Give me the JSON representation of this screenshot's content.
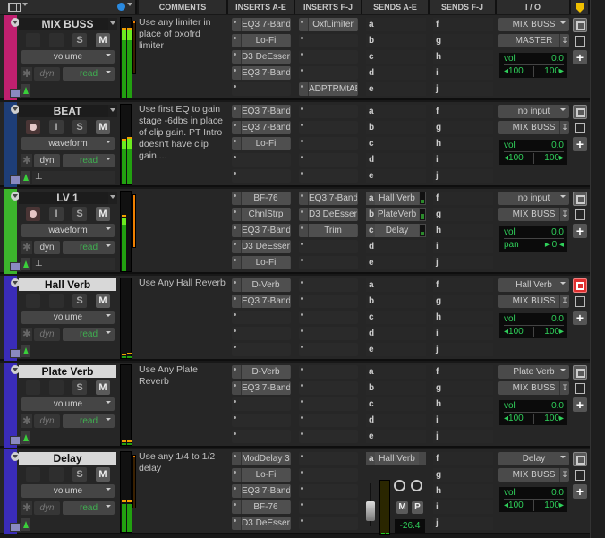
{
  "header": {
    "columns": [
      "COMMENTS",
      "INSERTS A-E",
      "INSERTS F-J",
      "SENDS A-E",
      "SENDS F-J",
      "I / O"
    ],
    "icons": [
      "track-view-icon",
      "wave-cache-icon",
      "marker-icon"
    ]
  },
  "colors": {
    "mix_buss": "#c0206f",
    "beat": "#1e3e78",
    "lv1": "#3cb52c",
    "aux": "#3a2cb8",
    "meter_green": "#22a010",
    "meter_bright": "#6cec20",
    "vol_text": "#2fd05a"
  },
  "tracks": [
    {
      "name": "MIX BUSS",
      "color": "#c0206f",
      "highlighted": false,
      "buttons": [
        "",
        "",
        "S",
        "M"
      ],
      "view": "volume",
      "auto_mode": "read",
      "dyn": "dyn",
      "comment": "Use any limiter in place of oxofrd limiter",
      "inserts_ae": [
        "EQ3 7-Band",
        "Lo-Fi",
        "D3 DeEsser",
        "EQ3 7-Band",
        ""
      ],
      "inserts_fj": [
        "OxfLimiter",
        "",
        "",
        "",
        "ADPTRMtAB"
      ],
      "sends_ae": [
        {
          "slot": "a",
          "name": ""
        },
        {
          "slot": "b",
          "name": ""
        },
        {
          "slot": "c",
          "name": ""
        },
        {
          "slot": "d",
          "name": ""
        },
        {
          "slot": "e",
          "name": ""
        }
      ],
      "sends_fj": [
        "f",
        "g",
        "h",
        "i",
        "j"
      ],
      "io": {
        "input": "MIX BUSS",
        "output": "MASTER",
        "vol_label": "vol",
        "vol": "0.0",
        "pan_left": "◂100",
        "pan_right": "100▸"
      }
    },
    {
      "name": "BEAT",
      "color": "#1e3e78",
      "highlighted": false,
      "buttons": [
        "rec",
        "I",
        "S",
        "M"
      ],
      "view": "waveform",
      "auto_mode": "read",
      "dyn": "dyn",
      "comment": "Use first EQ to gain stage -6dbs in place of clip gain. PT Intro doesn't have clip gain....",
      "inserts_ae": [
        "EQ3 7-Band",
        "EQ3 7-Band",
        "Lo-Fi",
        "",
        ""
      ],
      "inserts_fj": [
        "",
        "",
        "",
        "",
        ""
      ],
      "sends_ae": [
        {
          "slot": "a",
          "name": ""
        },
        {
          "slot": "b",
          "name": ""
        },
        {
          "slot": "c",
          "name": ""
        },
        {
          "slot": "d",
          "name": ""
        },
        {
          "slot": "e",
          "name": ""
        }
      ],
      "sends_fj": [
        "f",
        "g",
        "h",
        "i",
        "j"
      ],
      "io": {
        "input": "no input",
        "output": "MIX BUSS",
        "vol_label": "vol",
        "vol": "0.0",
        "pan_left": "◂100",
        "pan_right": "100▸"
      }
    },
    {
      "name": "LV 1",
      "color": "#3cb52c",
      "highlighted": false,
      "buttons": [
        "rec",
        "I",
        "S",
        "M"
      ],
      "view": "waveform",
      "auto_mode": "read",
      "dyn": "dyn",
      "comment": "",
      "inserts_ae": [
        "BF-76",
        "ChnlStrp",
        "EQ3 7-Band",
        "D3 DeEsser",
        "Lo-Fi"
      ],
      "inserts_fj": [
        "EQ3 7-Band",
        "D3 DeEsser",
        "Trim",
        "",
        ""
      ],
      "sends_ae": [
        {
          "slot": "a",
          "name": "Hall Verb"
        },
        {
          "slot": "b",
          "name": "PlateVerb"
        },
        {
          "slot": "c",
          "name": "Delay"
        },
        {
          "slot": "d",
          "name": ""
        },
        {
          "slot": "e",
          "name": ""
        }
      ],
      "sends_fj": [
        "f",
        "g",
        "h",
        "i",
        "j"
      ],
      "io": {
        "input": "no input",
        "output": "MIX BUSS",
        "vol_label": "vol",
        "vol": "0.0",
        "pan_left": "pan",
        "pan_right": "▸ 0 ◂"
      }
    },
    {
      "name": "Hall Verb",
      "color": "#3a2cb8",
      "highlighted": true,
      "buttons": [
        "",
        "",
        "S",
        "M"
      ],
      "view": "volume",
      "auto_mode": "read",
      "dyn": "dyn",
      "comment": "Use Any Hall Reverb",
      "inserts_ae": [
        "D-Verb",
        "EQ3 7-Band",
        "",
        "",
        ""
      ],
      "inserts_fj": [
        "",
        "",
        "",
        "",
        ""
      ],
      "sends_ae": [
        {
          "slot": "a",
          "name": ""
        },
        {
          "slot": "b",
          "name": ""
        },
        {
          "slot": "c",
          "name": ""
        },
        {
          "slot": "d",
          "name": ""
        },
        {
          "slot": "e",
          "name": ""
        }
      ],
      "sends_fj": [
        "f",
        "g",
        "h",
        "i",
        "j"
      ],
      "io": {
        "input": "Hall Verb",
        "output": "MIX BUSS",
        "vol_label": "vol",
        "vol": "0.0",
        "pan_left": "◂100",
        "pan_right": "100▸"
      }
    },
    {
      "name": "Plate Verb",
      "color": "#3a2cb8",
      "highlighted": true,
      "buttons": [
        "",
        "",
        "S",
        "M"
      ],
      "view": "volume",
      "auto_mode": "read",
      "dyn": "dyn",
      "comment": "Use Any Plate Reverb",
      "inserts_ae": [
        "D-Verb",
        "EQ3 7-Band",
        "",
        "",
        ""
      ],
      "inserts_fj": [
        "",
        "",
        "",
        "",
        ""
      ],
      "sends_ae": [
        {
          "slot": "a",
          "name": ""
        },
        {
          "slot": "b",
          "name": ""
        },
        {
          "slot": "c",
          "name": ""
        },
        {
          "slot": "d",
          "name": ""
        },
        {
          "slot": "e",
          "name": ""
        }
      ],
      "sends_fj": [
        "f",
        "g",
        "h",
        "i",
        "j"
      ],
      "io": {
        "input": "Plate Verb",
        "output": "MIX BUSS",
        "vol_label": "vol",
        "vol": "0.0",
        "pan_left": "◂100",
        "pan_right": "100▸"
      }
    },
    {
      "name": "Delay",
      "color": "#3a2cb8",
      "highlighted": true,
      "buttons": [
        "",
        "",
        "S",
        "M"
      ],
      "view": "volume",
      "auto_mode": "read",
      "dyn": "dyn",
      "comment": "Use any 1/4 to 1/2 delay",
      "inserts_ae": [
        "ModDelay 3",
        "Lo-Fi",
        "EQ3 7-Band",
        "BF-76",
        "D3 DeEsser"
      ],
      "inserts_fj": [
        "",
        "",
        "",
        "",
        ""
      ],
      "sends_ae": [
        {
          "slot": "a",
          "name": "Hall Verb"
        }
      ],
      "send_fader": {
        "m": "M",
        "p": "P",
        "level": "-26.4"
      },
      "sends_fj": [
        "f",
        "g",
        "h",
        "i",
        "j"
      ],
      "io": {
        "input": "Delay",
        "output": "MIX BUSS",
        "vol_label": "vol",
        "vol": "0.0",
        "pan_left": "◂100",
        "pan_right": "100▸"
      }
    }
  ]
}
